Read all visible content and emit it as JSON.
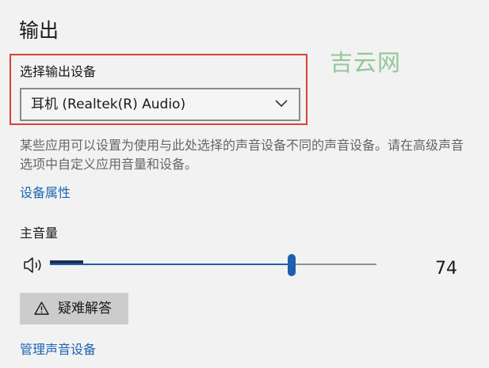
{
  "output": {
    "title": "输出",
    "select_label": "选择输出设备",
    "selected_device": "耳机 (Realtek(R) Audio)",
    "description": "某些应用可以设置为使用与此处选择的声音设备不同的声音设备。请在高级声音选项中自定义应用音量和设备。",
    "device_properties_link": "设备属性",
    "master_volume_label": "主音量",
    "volume_value": "74",
    "volume_level": 0.74,
    "troubleshoot_label": "疑难解答",
    "manage_devices_link": "管理声音设备"
  },
  "watermark": "吉云网",
  "icons": {
    "speaker": "speaker-icon",
    "dropdown": "chevron-down-icon",
    "warning": "warning-icon"
  },
  "colors": {
    "highlight": "#d9403a",
    "accent": "#1d5fb0",
    "link": "#1a66b0",
    "watermark": "#93c79a"
  }
}
